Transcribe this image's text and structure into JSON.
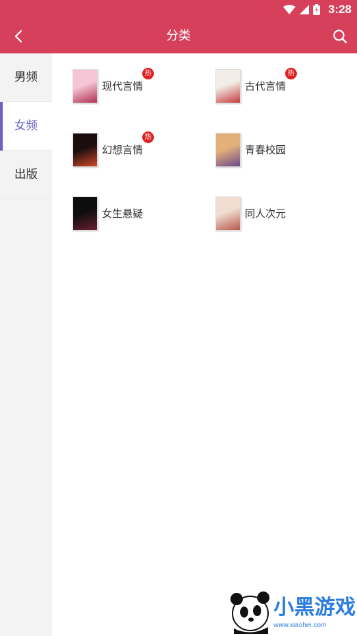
{
  "status": {
    "time": "3:28"
  },
  "header": {
    "title": "分类",
    "back_icon": "chevron-left-icon",
    "search_icon": "search-icon"
  },
  "colors": {
    "brand": "#d6405a",
    "accent": "#6c63c9",
    "hot": "#e02020"
  },
  "sidebar": {
    "items": [
      {
        "label": "男频",
        "active": false
      },
      {
        "label": "女频",
        "active": true
      },
      {
        "label": "出版",
        "active": false
      }
    ]
  },
  "categories": [
    {
      "label": "现代言情",
      "hot": "热",
      "cover_colors": [
        "#f7c6d6",
        "#b03050"
      ]
    },
    {
      "label": "古代言情",
      "hot": "热",
      "cover_colors": [
        "#f2ede6",
        "#c23b3b"
      ]
    },
    {
      "label": "幻想言情",
      "hot": "热",
      "cover_colors": [
        "#1a0d0d",
        "#d24a2a"
      ]
    },
    {
      "label": "青春校园",
      "hot": "",
      "cover_colors": [
        "#e3b07a",
        "#6a4a8a"
      ]
    },
    {
      "label": "女生悬疑",
      "hot": "",
      "cover_colors": [
        "#0d0d0d",
        "#6a2030"
      ]
    },
    {
      "label": "同人次元",
      "hot": "",
      "cover_colors": [
        "#f0dcd0",
        "#b8584a"
      ]
    }
  ],
  "watermark": {
    "name": "小黑游戏",
    "url": "www.xiaohei.com"
  }
}
